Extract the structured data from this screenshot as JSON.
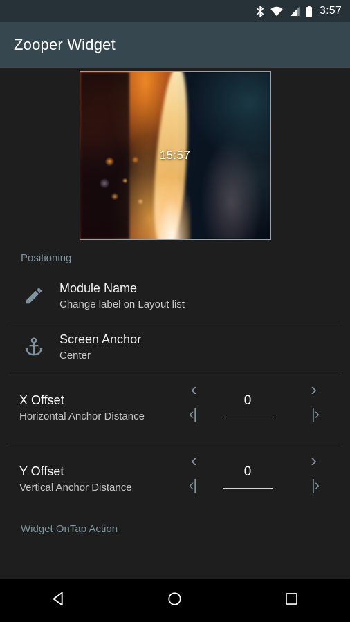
{
  "status_bar": {
    "bluetooth_icon": "bluetooth-icon",
    "wifi_icon": "wifi-icon",
    "signal_icon": "cellular-signal-icon",
    "battery_icon": "battery-icon",
    "clock": "3:57"
  },
  "app_bar": {
    "title": "Zooper Widget"
  },
  "preview": {
    "name": "widget-preview",
    "clock_text": "15:57"
  },
  "sections": {
    "positioning": "Positioning",
    "widget_ontap": "Widget OnTap Action"
  },
  "rows": {
    "module_name": {
      "icon": "pencil-icon",
      "title": "Module Name",
      "subtitle": "Change label on Layout list"
    },
    "screen_anchor": {
      "icon": "anchor-icon",
      "title": "Screen Anchor",
      "subtitle": "Center"
    },
    "x_offset": {
      "title": "X Offset",
      "subtitle": "Horizontal Anchor Distance",
      "value": "0",
      "dec_small": "‹",
      "inc_small": "›",
      "dec_large": "‹|",
      "inc_large": "|›"
    },
    "y_offset": {
      "title": "Y Offset",
      "subtitle": "Vertical Anchor Distance",
      "value": "0",
      "dec_small": "‹",
      "inc_small": "›",
      "dec_large": "‹|",
      "inc_large": "|›"
    }
  },
  "nav_bar": {
    "back": "back-icon",
    "home": "home-icon",
    "recents": "recents-icon"
  },
  "colors": {
    "status_bar_bg": "#263238",
    "app_bar_bg": "#37474f",
    "content_bg": "#1e1e1e",
    "accent": "#7e939e",
    "divider": "#3a3a3a",
    "primary_text": "#f2f2f2",
    "secondary_text": "#c8c8c8",
    "nav_bar_bg": "#000000"
  }
}
